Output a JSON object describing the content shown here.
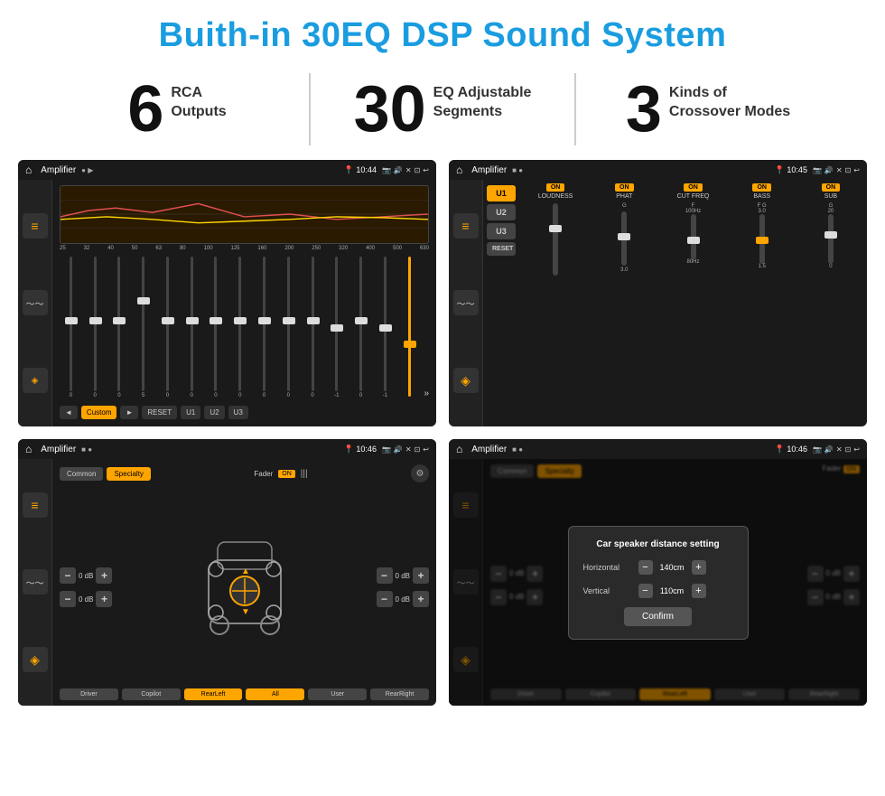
{
  "page": {
    "title": "Buith-in 30EQ DSP Sound System"
  },
  "stats": [
    {
      "number": "6",
      "label": "RCA\nOutputs"
    },
    {
      "number": "30",
      "label": "EQ Adjustable\nSegments"
    },
    {
      "number": "3",
      "label": "Kinds of\nCrossover Modes"
    }
  ],
  "screens": [
    {
      "id": "screen1",
      "status_bar": {
        "app": "Amplifier",
        "time": "10:44"
      },
      "eq_freqs": [
        "25",
        "32",
        "40",
        "50",
        "63",
        "80",
        "100",
        "125",
        "160",
        "200",
        "250",
        "320",
        "400",
        "500",
        "630"
      ],
      "eq_values": [
        "0",
        "0",
        "0",
        "5",
        "0",
        "0",
        "0",
        "0",
        "0",
        "0",
        "0",
        "-1",
        "0",
        "-1"
      ],
      "buttons": [
        "◄",
        "Custom",
        "►",
        "RESET",
        "U1",
        "U2",
        "U3"
      ]
    },
    {
      "id": "screen2",
      "status_bar": {
        "app": "Amplifier",
        "time": "10:45"
      },
      "channels": [
        "U1",
        "U2",
        "U3"
      ],
      "sections": [
        "LOUDNESS",
        "PHAT",
        "CUT FREQ",
        "BASS",
        "SUB"
      ]
    },
    {
      "id": "screen3",
      "status_bar": {
        "app": "Amplifier",
        "time": "10:46"
      },
      "tabs": [
        "Common",
        "Specialty"
      ],
      "fader": "Fader",
      "db_values": [
        "0 dB",
        "0 dB",
        "0 dB",
        "0 dB"
      ],
      "bottom_buttons": [
        "Driver",
        "",
        "",
        "",
        "",
        "User",
        "",
        "RearRight"
      ],
      "bottom_row": [
        "Driver",
        "Copilot",
        "RearLeft",
        "All",
        "User",
        "RearRight"
      ]
    },
    {
      "id": "screen4",
      "status_bar": {
        "app": "Amplifier",
        "time": "10:46"
      },
      "tabs": [
        "Common",
        "Specialty"
      ],
      "dialog": {
        "title": "Car speaker distance setting",
        "horizontal_label": "Horizontal",
        "horizontal_value": "140cm",
        "vertical_label": "Vertical",
        "vertical_value": "110cm",
        "confirm_label": "Confirm"
      },
      "bottom_row": [
        "Driver",
        "Copilot",
        "RearLeft",
        "All",
        "User",
        "RearRight"
      ]
    }
  ]
}
